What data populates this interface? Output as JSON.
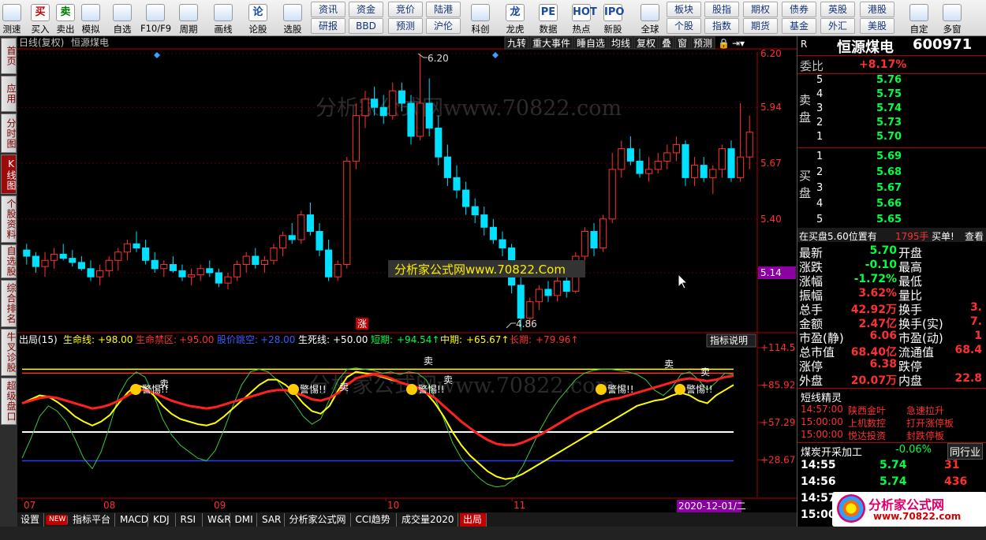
{
  "toolbar": {
    "items": [
      {
        "key": "ceshu",
        "label": "测速",
        "icon": "speed-icon"
      },
      {
        "key": "buy",
        "label": "买入",
        "glyph": "买",
        "color": "#c00000"
      },
      {
        "key": "sell",
        "label": "卖出",
        "glyph": "卖",
        "color": "#007a00"
      },
      {
        "key": "sim",
        "label": "模拟",
        "icon": "hammer-icon"
      },
      {
        "key": "zixuan",
        "label": "自选",
        "icon": "star-icon"
      },
      {
        "key": "f10",
        "label": "F10/F9",
        "icon": "panel-icon"
      },
      {
        "key": "zhouqi",
        "label": "周期",
        "icon": "clock-icon"
      },
      {
        "key": "huaxian",
        "label": "画线",
        "icon": "pencil-icon"
      },
      {
        "key": "lungu",
        "label": "论股",
        "icon": "speech-icon",
        "glyph": "论"
      },
      {
        "key": "xuangu",
        "label": "选股",
        "icon": "magnifier-icon"
      },
      {
        "key": "keshi",
        "label": "科创",
        "icon": "chart-icon"
      },
      {
        "key": "longhu",
        "label": "龙虎",
        "icon": "dragon-icon",
        "glyph": "龙"
      },
      {
        "key": "shuju",
        "label": "数据",
        "icon": "pe-icon",
        "glyph": "PE"
      },
      {
        "key": "redian",
        "label": "热点",
        "icon": "hot-icon",
        "glyph": "HOT"
      },
      {
        "key": "xingu",
        "label": "新股",
        "icon": "ipo-icon",
        "glyph": "IPO"
      },
      {
        "key": "quanqiu",
        "label": "全球",
        "icon": "globe-icon"
      },
      {
        "key": "zidingyi",
        "label": "自定",
        "icon": "edit-icon"
      },
      {
        "key": "duochuang",
        "label": "多窗",
        "icon": "windows-icon"
      }
    ],
    "small_buttons": [
      [
        "资讯",
        "资金",
        "竞价",
        "陆港"
      ],
      [
        "研报",
        "BBD",
        "预测",
        "沪伦"
      ],
      [
        "板块",
        "股指",
        "期权",
        "债券",
        "英股",
        "港股"
      ],
      [
        "个股",
        "指数",
        "期货",
        "基金",
        "外汇",
        "美股"
      ]
    ]
  },
  "sidebar": {
    "tabs": [
      "首页",
      "应用",
      "分时图",
      "K线图",
      "个股资料",
      "自选股",
      "综合排名",
      "牛叉诊股",
      "超级盘口"
    ]
  },
  "chart": {
    "period_label": "日线(复权)",
    "stock_name": "恒源煤电",
    "top_buttons": [
      "九转",
      "重大事件",
      "睡自选",
      "均线",
      "复权",
      "叠",
      "窗",
      "预测"
    ],
    "y_ticks": [
      "6.20",
      "5.94",
      "5.67",
      "5.40",
      "5.14"
    ],
    "current_price": "5.14",
    "high_marker": "6.20",
    "low_marker": "4.86",
    "rise_marker": "涨",
    "watermark": "分析家公式网www.70822.com",
    "watermark2": "分析家公式网www.70822.Com",
    "candles": [
      [
        5.25,
        5.28,
        5.18,
        5.22
      ],
      [
        5.22,
        5.24,
        5.14,
        5.17
      ],
      [
        5.17,
        5.24,
        5.12,
        5.2
      ],
      [
        5.2,
        5.26,
        5.16,
        5.23
      ],
      [
        5.23,
        5.28,
        5.2,
        5.21
      ],
      [
        5.21,
        5.25,
        5.17,
        5.19
      ],
      [
        5.19,
        5.22,
        5.15,
        5.16
      ],
      [
        5.16,
        5.2,
        5.1,
        5.12
      ],
      [
        5.12,
        5.18,
        5.08,
        5.15
      ],
      [
        5.15,
        5.22,
        5.12,
        5.2
      ],
      [
        5.2,
        5.26,
        5.15,
        5.24
      ],
      [
        5.24,
        5.3,
        5.2,
        5.28
      ],
      [
        5.28,
        5.34,
        5.24,
        5.26
      ],
      [
        5.26,
        5.3,
        5.18,
        5.2
      ],
      [
        5.2,
        5.24,
        5.14,
        5.16
      ],
      [
        5.16,
        5.2,
        5.12,
        5.18
      ],
      [
        5.18,
        5.22,
        5.14,
        5.15
      ],
      [
        5.15,
        5.18,
        5.1,
        5.12
      ],
      [
        5.12,
        5.16,
        5.08,
        5.13
      ],
      [
        5.13,
        5.18,
        5.1,
        5.16
      ],
      [
        5.16,
        5.2,
        5.12,
        5.14
      ],
      [
        5.14,
        5.16,
        5.07,
        5.09
      ],
      [
        5.09,
        5.14,
        5.06,
        5.12
      ],
      [
        5.12,
        5.2,
        5.1,
        5.18
      ],
      [
        5.18,
        5.24,
        5.14,
        5.22
      ],
      [
        5.22,
        5.26,
        5.16,
        5.18
      ],
      [
        5.18,
        5.22,
        5.14,
        5.2
      ],
      [
        5.2,
        5.28,
        5.18,
        5.26
      ],
      [
        5.26,
        5.34,
        5.22,
        5.32
      ],
      [
        5.32,
        5.38,
        5.28,
        5.3
      ],
      [
        5.3,
        5.44,
        5.28,
        5.42
      ],
      [
        5.42,
        5.48,
        5.32,
        5.34
      ],
      [
        5.34,
        5.38,
        5.22,
        5.25
      ],
      [
        5.25,
        5.3,
        5.1,
        5.12
      ],
      [
        5.12,
        5.2,
        5.1,
        5.18
      ],
      [
        5.18,
        5.7,
        5.16,
        5.68
      ],
      [
        5.68,
        5.96,
        5.64,
        5.9
      ],
      [
        5.9,
        6.02,
        5.84,
        5.98
      ],
      [
        5.98,
        6.04,
        5.9,
        5.94
      ],
      [
        5.94,
        6.0,
        5.86,
        5.9
      ],
      [
        5.9,
        6.06,
        5.88,
        6.02
      ],
      [
        6.02,
        6.06,
        5.92,
        5.96
      ],
      [
        5.96,
        6.0,
        5.76,
        5.8
      ],
      [
        5.8,
        6.2,
        5.78,
        5.96
      ],
      [
        5.96,
        6.08,
        5.8,
        5.84
      ],
      [
        5.84,
        5.9,
        5.66,
        5.7
      ],
      [
        5.7,
        5.76,
        5.56,
        5.6
      ],
      [
        5.6,
        5.66,
        5.5,
        5.54
      ],
      [
        5.54,
        5.58,
        5.42,
        5.46
      ],
      [
        5.46,
        5.5,
        5.38,
        5.42
      ],
      [
        5.42,
        5.46,
        5.32,
        5.36
      ],
      [
        5.36,
        5.4,
        5.28,
        5.3
      ],
      [
        5.3,
        5.34,
        5.22,
        5.26
      ],
      [
        5.26,
        5.28,
        5.04,
        5.08
      ],
      [
        5.08,
        5.16,
        4.86,
        4.92
      ],
      [
        4.92,
        5.02,
        4.88,
        5.0
      ],
      [
        5.0,
        5.08,
        4.96,
        5.06
      ],
      [
        5.06,
        5.1,
        5.0,
        5.03
      ],
      [
        5.03,
        5.12,
        5.0,
        5.1
      ],
      [
        5.1,
        5.14,
        5.02,
        5.05
      ],
      [
        5.05,
        5.24,
        5.04,
        5.22
      ],
      [
        5.22,
        5.36,
        5.18,
        5.34
      ],
      [
        5.34,
        5.38,
        5.22,
        5.26
      ],
      [
        5.26,
        5.42,
        5.24,
        5.4
      ],
      [
        5.4,
        5.72,
        5.38,
        5.64
      ],
      [
        5.64,
        5.78,
        5.6,
        5.74
      ],
      [
        5.74,
        5.8,
        5.66,
        5.68
      ],
      [
        5.68,
        5.74,
        5.6,
        5.62
      ],
      [
        5.62,
        5.7,
        5.58,
        5.64
      ],
      [
        5.64,
        5.72,
        5.62,
        5.68
      ],
      [
        5.68,
        5.76,
        5.64,
        5.72
      ],
      [
        5.72,
        5.8,
        5.68,
        5.76
      ],
      [
        5.76,
        5.78,
        5.56,
        5.6
      ],
      [
        5.6,
        5.7,
        5.56,
        5.66
      ],
      [
        5.66,
        5.7,
        5.58,
        5.6
      ],
      [
        5.6,
        5.66,
        5.52,
        5.64
      ],
      [
        5.64,
        5.76,
        5.6,
        5.74
      ],
      [
        5.74,
        5.78,
        5.58,
        5.6
      ],
      [
        5.6,
        5.96,
        5.58,
        5.7
      ],
      [
        5.7,
        5.9,
        5.64,
        5.82
      ]
    ],
    "indicator": {
      "name": "出局(15)",
      "params": [
        {
          "k": "生命线:",
          "v": "+98.00",
          "c": "#ffff00"
        },
        {
          "k": "生命禁区:",
          "v": "+95.00",
          "c": "#ff3030"
        },
        {
          "k": "股价跳空:",
          "v": "+28.00",
          "c": "#3a5cff"
        },
        {
          "k": "生死线:",
          "v": "+50.00",
          "c": "#ffffff"
        },
        {
          "k": "短期:",
          "v": "+94.54↑",
          "c": "#00ff40"
        },
        {
          "k": "中期:",
          "v": "+65.67↑",
          "c": "#ffff00"
        },
        {
          "k": "长期:",
          "v": "+79.96↑",
          "c": "#ff3030"
        }
      ],
      "explain_btn": "指标说明",
      "y_ticks": [
        "+114.5",
        "+85.92",
        "+57.29",
        "+28.67"
      ],
      "sell_text": "卖",
      "warn_text": "警惕!!"
    },
    "x_labels": [
      "07",
      "08",
      "09",
      "10",
      "11"
    ],
    "date_label": "2020-12-01/二"
  },
  "bottom_tabs": [
    "设置",
    "NEW",
    "指标平台",
    "MACD",
    "KDJ",
    "RSI",
    "W&R",
    "DMI",
    "SAR",
    "分析家公式网",
    "CCI趋势",
    "成交量2020",
    "出局"
  ],
  "right": {
    "flag": "R",
    "name": "恒源煤电",
    "code": "600971",
    "weibi_label": "委比",
    "weibi": "+8.17%",
    "sell_label": "卖盘",
    "buy_label": "买盘",
    "asks": [
      [
        "5",
        "5.76"
      ],
      [
        "4",
        "5.75"
      ],
      [
        "3",
        "5.74"
      ],
      [
        "2",
        "5.73"
      ],
      [
        "1",
        "5.70"
      ]
    ],
    "bids": [
      [
        "1",
        "5.69"
      ],
      [
        "2",
        "5.68"
      ],
      [
        "3",
        "5.67"
      ],
      [
        "4",
        "5.66"
      ],
      [
        "5",
        "5.65"
      ]
    ],
    "notice": "在买盘5.60位置有",
    "notice_vol": "1795手",
    "notice_tail": "买单!",
    "notice_more": "查看",
    "quotes": [
      [
        "最新",
        "5.70",
        "开盘",
        ""
      ],
      [
        "涨跌",
        "-0.10",
        "最高",
        ""
      ],
      [
        "涨幅",
        "-1.72%",
        "最低",
        ""
      ],
      [
        "振幅",
        "3.62%",
        "量比",
        ""
      ],
      [
        "总手",
        "42.92万",
        "换手",
        "3."
      ],
      [
        "金额",
        "2.47亿",
        "换手(实)",
        "7."
      ],
      [
        "市盈(静)",
        "6.06",
        "市盈(动)",
        "1"
      ],
      [
        "总市值",
        "68.40亿",
        "流通值",
        "68.4"
      ],
      [
        "涨停",
        "6.38",
        "跌停",
        ""
      ],
      [
        "外盘",
        "20.07万",
        "内盘",
        "22.8"
      ]
    ],
    "jingling_label": "短线精灵",
    "jingling": [
      [
        "14:57:00",
        "陕西金叶",
        "急速拉升"
      ],
      [
        "15:00:00",
        "上机数控",
        "打开涨停板"
      ],
      [
        "15:00:00",
        "悦达投资",
        "封跌停板"
      ]
    ],
    "industry": "煤炭开采加工",
    "industry_chg": "-0.06%",
    "industry_btn": "同行业",
    "ticks": [
      [
        "14:55",
        "5.74",
        "31"
      ],
      [
        "14:56",
        "5.74",
        "436"
      ],
      [
        "14:57",
        "5.74",
        ""
      ],
      [
        "15:00",
        "",
        ""
      ]
    ],
    "logo": "分析家公式网",
    "logo_url": "www.70822.com"
  }
}
